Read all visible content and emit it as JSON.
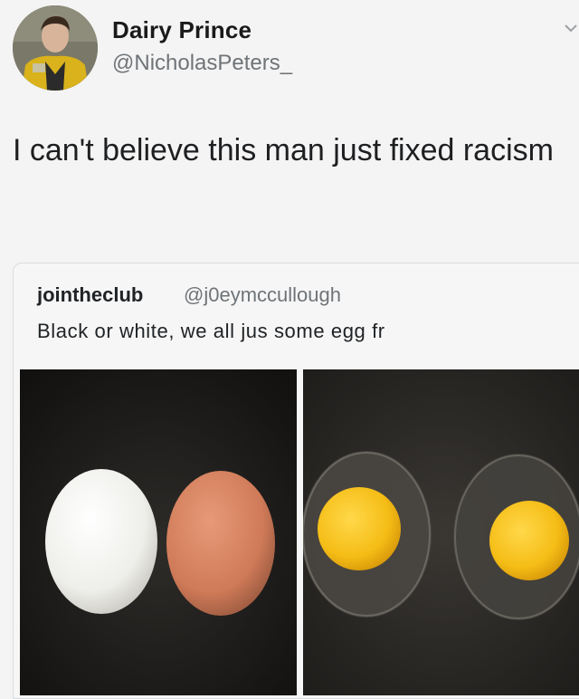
{
  "author": {
    "display_name": "Dairy Prince",
    "handle": "@NicholasPeters_",
    "avatar_icon": "profile-photo"
  },
  "tweet": {
    "text": "I can't believe this man just fixed racism"
  },
  "quoted_tweet": {
    "display_name": "jointheclub",
    "handle": "@j0eymccullough",
    "text": "Black or white, we all jus some egg fr",
    "images": [
      {
        "name": "whole-eggs-photo",
        "description_icon": "white-and-brown-eggs"
      },
      {
        "name": "cracked-eggs-photo",
        "description_icon": "two-fried-egg-yolks"
      }
    ]
  },
  "colors": {
    "background": "#f4f4f4",
    "handle_gray": "#6f7478",
    "text": "#1e1f21",
    "yolk": "#f5bd16"
  }
}
